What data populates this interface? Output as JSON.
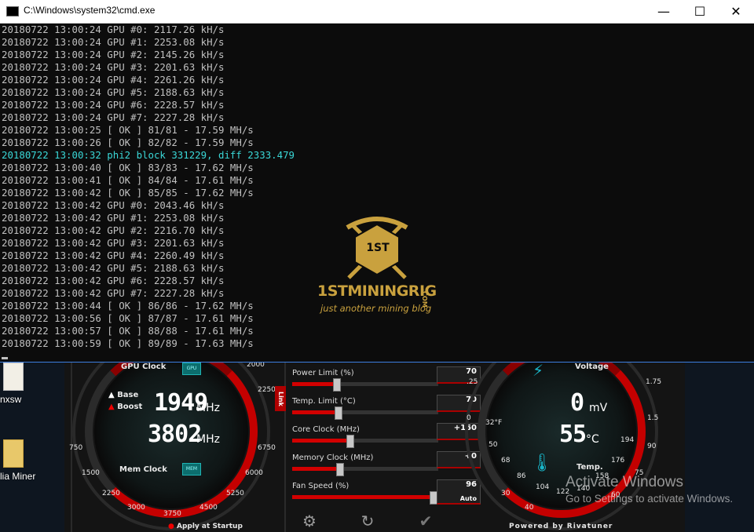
{
  "window": {
    "title": "C:\\Windows\\system32\\cmd.exe",
    "minimize_glyph": "—",
    "maximize_glyph": "☐",
    "close_glyph": "✕"
  },
  "console_lines": [
    "20180722 13:00:24 GPU #0: 2117.26 kH/s",
    "20180722 13:00:24 GPU #1: 2253.08 kH/s",
    "20180722 13:00:24 GPU #2: 2145.26 kH/s",
    "20180722 13:00:24 GPU #3: 2201.63 kH/s",
    "20180722 13:00:24 GPU #4: 2261.26 kH/s",
    "20180722 13:00:24 GPU #5: 2188.63 kH/s",
    "20180722 13:00:24 GPU #6: 2228.57 kH/s",
    "20180722 13:00:24 GPU #7: 2227.28 kH/s",
    "20180722 13:00:25 [ OK ] 81/81 - 17.59 MH/s",
    "20180722 13:00:26 [ OK ] 82/82 - 17.59 MH/s",
    "20180722 13:00:32 phi2 block 331229, diff 2333.479",
    "20180722 13:00:40 [ OK ] 83/83 - 17.62 MH/s",
    "20180722 13:00:41 [ OK ] 84/84 - 17.61 MH/s",
    "20180722 13:00:42 [ OK ] 85/85 - 17.62 MH/s",
    "20180722 13:00:42 GPU #0: 2043.46 kH/s",
    "20180722 13:00:42 GPU #1: 2253.08 kH/s",
    "20180722 13:00:42 GPU #2: 2216.70 kH/s",
    "20180722 13:00:42 GPU #3: 2201.63 kH/s",
    "20180722 13:00:42 GPU #4: 2260.49 kH/s",
    "20180722 13:00:42 GPU #5: 2188.63 kH/s",
    "20180722 13:00:42 GPU #6: 2228.57 kH/s",
    "20180722 13:00:42 GPU #7: 2227.28 kH/s",
    "20180722 13:00:44 [ OK ] 86/86 - 17.62 MH/s",
    "20180722 13:00:56 [ OK ] 87/87 - 17.61 MH/s",
    "20180722 13:00:57 [ OK ] 88/88 - 17.61 MH/s",
    "20180722 13:00:59 [ OK ] 89/89 - 17.63 MH/s"
  ],
  "console_highlight_line_index": 10,
  "colors": {
    "console_text": "#c0c0c0",
    "console_highlight": "#3ad7d7",
    "accent_red": "#d20000",
    "logo_gold": "#c9a13e"
  },
  "watermark": {
    "badge": "1ST",
    "name": "1STMININGRIG",
    "domain": ".COM",
    "tagline": "just another mining blog"
  },
  "desktop": {
    "icons": [
      {
        "label": "nxsw"
      },
      {
        "label": "lia Miner"
      }
    ]
  },
  "afterburner": {
    "left_gauge": {
      "title": "GPU Clock",
      "bottom_title": "Mem Clock",
      "gpu_chip": "GPU",
      "mem_chip": "MEM",
      "base_label": "Base",
      "boost_label": "Boost",
      "gpu_clock_value": "1949",
      "gpu_clock_unit": "MHz",
      "mem_clock_value": "3802",
      "mem_clock_unit": "MHz",
      "ticks": [
        "2000",
        "2250",
        "6750",
        "6000",
        "5250",
        "4500",
        "3750",
        "3000",
        "2250",
        "1500",
        "750"
      ],
      "startup_label": "Apply at Startup"
    },
    "link_label": "Link",
    "sliders": [
      {
        "label": "Power Limit (%)",
        "value": "70",
        "level": 0.3
      },
      {
        "label": "Temp. Limit (°C)",
        "value": "70",
        "level": 0.31
      },
      {
        "label": "Core Clock (MHz)",
        "value": "+150",
        "level": 0.39
      },
      {
        "label": "Memory Clock (MHz)",
        "value": "+0",
        "level": 0.32
      },
      {
        "label": "Fan Speed (%)",
        "value": "96",
        "level": 0.96,
        "sub": "Auto"
      }
    ],
    "right_gauge": {
      "title": "Voltage",
      "voltage_value": "0",
      "voltage_unit": "mV",
      "temp_value": "55",
      "temp_unit": "°C",
      "temp_title": "Temp.",
      "fahrenheit_label": "32°F",
      "ticks": [
        ".25",
        "0",
        "50",
        "68",
        "86",
        "104",
        "122",
        "140",
        "158",
        "176",
        "194",
        "90",
        "1.75",
        "1.5",
        "75",
        "60",
        "40",
        "30"
      ],
      "powered_label": "Powered by Rivatuner"
    }
  },
  "activate": {
    "heading": "Activate Windows",
    "subtext": "Go to Settings to activate Windows."
  }
}
